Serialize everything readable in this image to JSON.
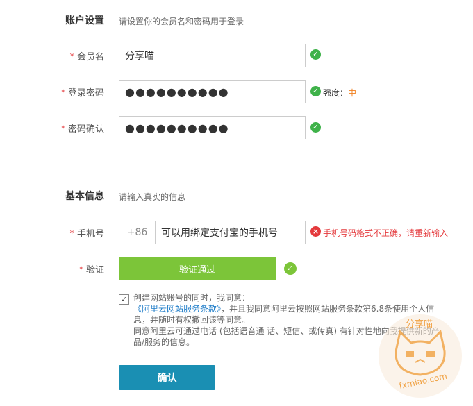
{
  "account": {
    "title": "账户设置",
    "hint": "请设置你的会员名和密码用于登录",
    "username_label": "会员名",
    "username_value": "分享喵",
    "password_label": "登录密码",
    "password_value": "●●●●●●●●●●",
    "strength_label": "强度：",
    "strength_value": "中",
    "confirm_label": "密码确认",
    "confirm_value": "●●●●●●●●●●"
  },
  "basic": {
    "title": "基本信息",
    "hint": "请输入真实的信息",
    "phone_label": "手机号",
    "phone_prefix": "+86",
    "phone_value": "可以用绑定支付宝的手机号",
    "phone_error": "手机号码格式不正确，请重新输入",
    "verify_label": "验证",
    "verify_text": "验证通过"
  },
  "agreement": {
    "line1": "创建网站账号的同时，我同意：",
    "link": "《阿里云网站服务条款》",
    "line2": "，并且我同意阿里云按照网站服务条款第6.8条使用个人信",
    "line3": "息，并随时有权撤回该等同意。",
    "line4": "同意阿里云可通过电话 (包括语音通 话、短信、或传真) 有针对性地向我提供新的产",
    "line5": "品/服务的信息。"
  },
  "submit_label": "确认",
  "watermark": {
    "text": "分享喵",
    "url": "fxmiao.com"
  },
  "colors": {
    "success": "#3fb24a",
    "error": "#e4393c",
    "strength": "#f08020",
    "primary": "#1a8fb3",
    "slider": "#7cc539",
    "link": "#1e7cc8"
  }
}
